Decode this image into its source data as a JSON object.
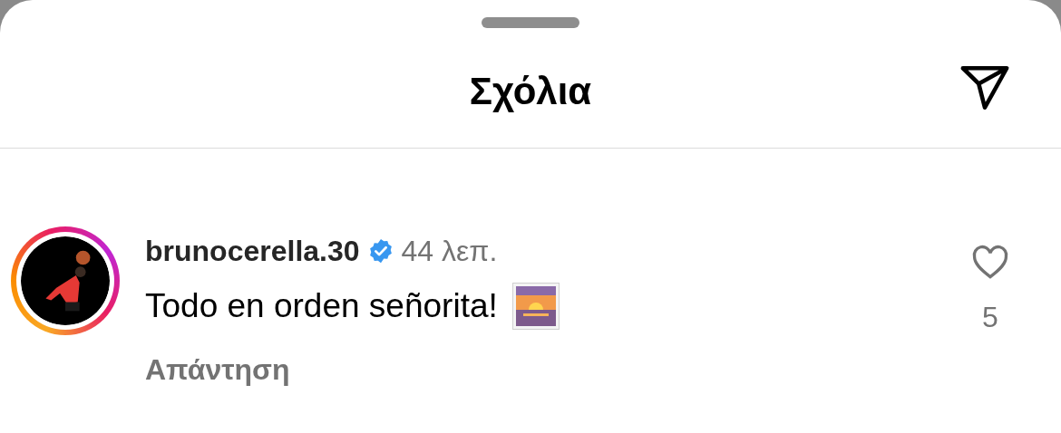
{
  "header": {
    "title": "Σχόλια"
  },
  "comments": [
    {
      "username": "brunocerella.30",
      "verified": true,
      "time": "44 λεπ.",
      "text": "Todo en orden señorita!",
      "reply_label": "Απάντηση",
      "liked": false,
      "like_count": "5"
    }
  ]
}
